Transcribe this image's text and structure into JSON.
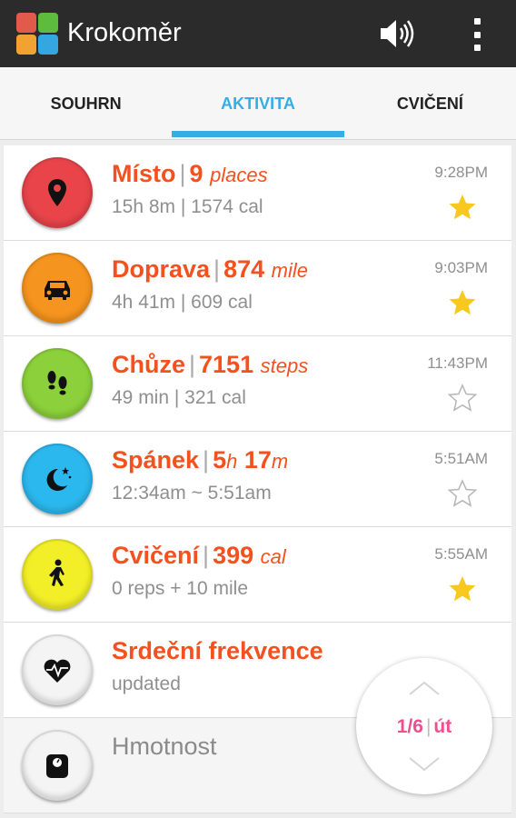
{
  "app": {
    "title": "Krokoměr"
  },
  "tabs": [
    {
      "label": "SOUHRN",
      "active": false
    },
    {
      "label": "AKTIVITA",
      "active": true
    },
    {
      "label": "CVIČENÍ",
      "active": false
    }
  ],
  "colors": {
    "accent": "#33aee6",
    "title_orange": "#f4511e",
    "pager_pink": "#ef4f8f",
    "star_gold": "#f9c81e"
  },
  "activities": [
    {
      "icon": "location-pin-icon",
      "color": "#e8444a",
      "title": "Místo",
      "value": "9",
      "unit": "places",
      "sub": "15h 8m  |  1574 cal",
      "time": "9:28PM",
      "starred": true
    },
    {
      "icon": "car-icon",
      "color": "#f5941e",
      "title": "Doprava",
      "value": "874",
      "unit": "mile",
      "sub": "4h 41m  |  609 cal",
      "time": "9:03PM",
      "starred": true
    },
    {
      "icon": "footsteps-icon",
      "color": "#8cd13b",
      "title": "Chůze",
      "value": "7151",
      "unit": "steps",
      "sub": "49 min  |  321 cal",
      "time": "11:43PM",
      "starred": false
    },
    {
      "icon": "moon-stars-icon",
      "color": "#2bb8ee",
      "title": "Spánek",
      "value_parts": [
        "5",
        "h",
        "17",
        "m"
      ],
      "sub": "12:34am ~ 5:51am",
      "time": "5:51AM",
      "starred": false
    },
    {
      "icon": "walking-person-icon",
      "color": "#f2ee27",
      "title": "Cvičení",
      "value": "399",
      "unit": "cal",
      "sub": "0 reps + 10 mile",
      "time": "5:55AM",
      "starred": true
    },
    {
      "icon": "heart-rate-icon",
      "color": "#f4f4f4",
      "title": "Srdeční frekvence",
      "sub": "updated"
    },
    {
      "icon": "scale-icon",
      "color": "#f4f4f4",
      "title": "Hmotnost"
    }
  ],
  "pager": {
    "page": "1/6",
    "day": "út"
  }
}
